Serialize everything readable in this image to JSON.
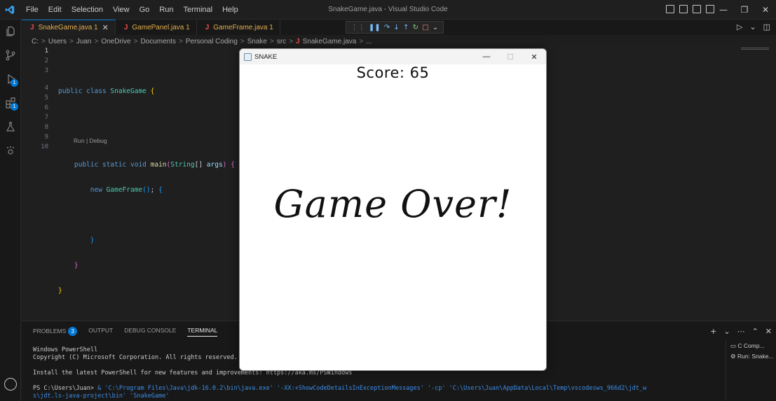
{
  "titlebar": {
    "menu": [
      "File",
      "Edit",
      "Selection",
      "View",
      "Go",
      "Run",
      "Terminal",
      "Help"
    ],
    "window_title": "SnakeGame.java - Visual Studio Code"
  },
  "activity": {
    "run_badge": "1",
    "extensions_badge": "1"
  },
  "tabs": [
    {
      "label": "SnakeGame.java 1",
      "active": true
    },
    {
      "label": "GamePanel.java 1",
      "active": false
    },
    {
      "label": "GameFrame.java 1",
      "active": false
    }
  ],
  "tab_icon": "J",
  "breadcrumb": [
    "C:",
    "Users",
    "Juan",
    "OneDrive",
    "Documents",
    "Personal Coding",
    "Snake",
    "src",
    "SnakeGame.java",
    "..."
  ],
  "editor": {
    "line_numbers": [
      "1",
      "2",
      "3",
      "4",
      "5",
      "6",
      "7",
      "8",
      "9",
      "10"
    ],
    "code_lens": "Run | Debug",
    "lines": {
      "l2_kw1": "public",
      "l2_kw2": "class",
      "l2_cls": "SnakeGame",
      "l2_br": "{",
      "l4_kw1": "public",
      "l4_kw2": "static",
      "l4_kw3": "void",
      "l4_fn": "main",
      "l4_open": "(",
      "l4_type": "String",
      "l4_arr": "[]",
      "l4_arg": "args",
      "l4_close": ")",
      "l4_br": "{",
      "l5_kw": "new",
      "l5_cls": "GameFrame",
      "l5_paren": "()",
      "l5_semi": ";",
      "l5_br": "{",
      "l7_br": "}",
      "l8_br": "}",
      "l9_br": "}"
    }
  },
  "panel": {
    "tabs": [
      "PROBLEMS",
      "OUTPUT",
      "DEBUG CONSOLE",
      "TERMINAL"
    ],
    "problems_count": "3",
    "terminal": {
      "line1": "Windows PowerShell",
      "line2": "Copyright (C) Microsoft Corporation. All rights reserved.",
      "line3": "Install the latest PowerShell for new features and improvements! https://aka.ms/PSWindows",
      "prompt": "PS C:\\Users\\Juan> ",
      "cmd": "& 'C:\\Program Files\\Java\\jdk-16.0.2\\bin\\java.exe' '-XX:+ShowCodeDetailsInExceptionMessages' '-cp' 'C:\\Users\\Juan\\AppData\\Local\\Temp\\vscodesws_966d2\\jdt_w",
      "cmd2": "s\\jdt.ls-java-project\\bin' 'SnakeGame'"
    },
    "terminal_list": [
      "C Comp...",
      "Run: Snake..."
    ]
  },
  "snake_window": {
    "title": "SNAKE",
    "score_text": "Score: 65",
    "gameover_text": "Game Over!"
  }
}
